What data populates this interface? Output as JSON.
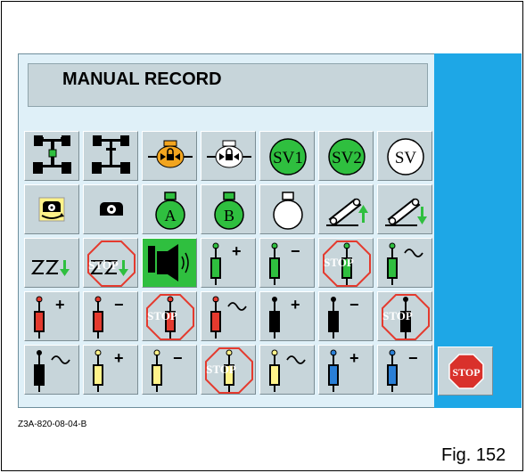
{
  "title": "MANUAL RECORD",
  "caption": "Z3A-820-08-04-B",
  "figure_label": "Fig. 152",
  "colors": {
    "screen_bg": "#dff0f8",
    "side_bar": "#1ea7e6",
    "button": "#c7d5da",
    "green": "#2fbf3f",
    "red": "#e43a2e",
    "yellow": "#fff38a",
    "blue": "#2a7fd6",
    "stop_red": "#d9312b"
  },
  "buttons": {
    "sv1": "SV1",
    "sv2": "SV2",
    "sv": "SV",
    "a": "A",
    "b": "B",
    "stop_overlay": "STOP",
    "stop": "STOP",
    "plus": "+",
    "minus": "−"
  },
  "icons": [
    [
      "axle-center-icon",
      "axle-disconnect-icon",
      "engine-lock-icon",
      "engine-unlock-icon",
      "sv1-icon",
      "sv2-icon",
      "sv-icon"
    ],
    [
      "pto-yellow-icon",
      "pto-icon",
      "tank-a-icon",
      "tank-b-icon",
      "tank-empty-icon",
      "arm-up-icon",
      "arm-down-icon"
    ],
    [
      "mode-22-icon",
      "mode-22-stop-icon",
      "horn-icon",
      "green-valve-plus-icon",
      "green-valve-minus-icon",
      "green-valve-stop-icon",
      "green-valve-float-icon"
    ],
    [
      "red-valve-plus-icon",
      "red-valve-minus-icon",
      "red-valve-stop-icon",
      "red-valve-float-icon",
      "black-valve-plus-icon",
      "black-valve-minus-icon",
      "black-valve-stop-icon"
    ],
    [
      "black-valve-float-icon",
      "yellow-valve-plus-icon",
      "yellow-valve-minus-icon",
      "yellow-valve-stop-icon",
      "yellow-valve-float-icon",
      "blue-valve-plus-icon",
      "blue-valve-minus-icon"
    ]
  ]
}
